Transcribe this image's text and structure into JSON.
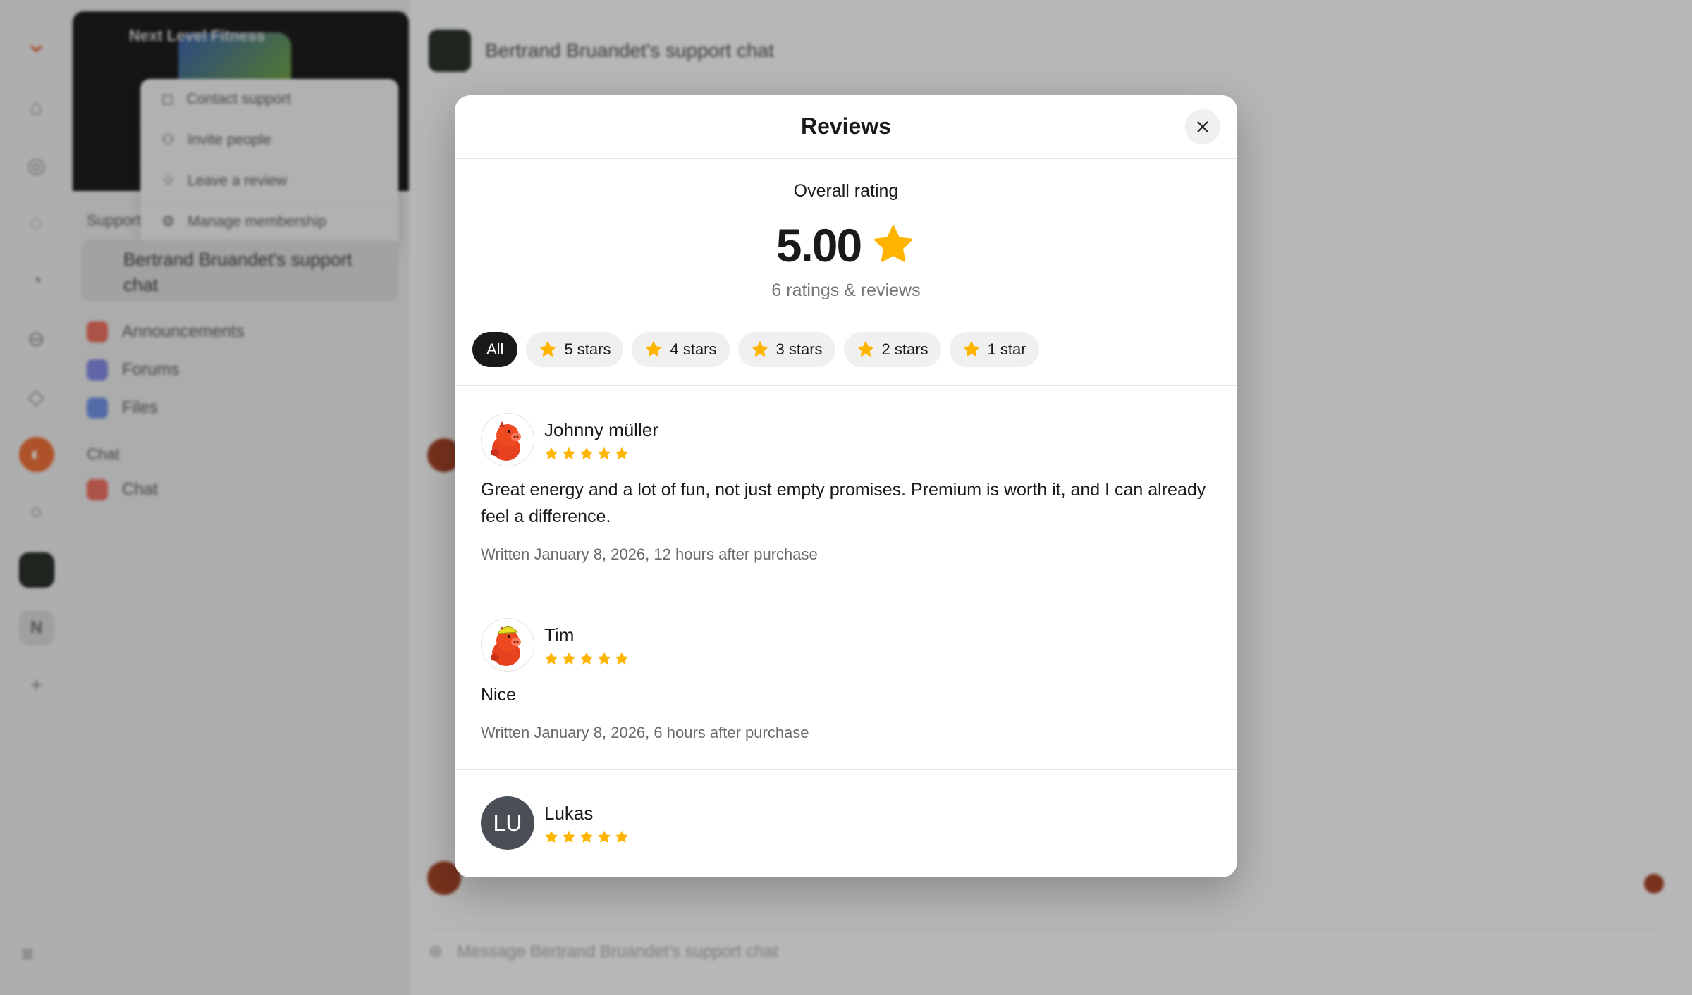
{
  "background": {
    "server_name": "Next Level Fitness",
    "context_menu": [
      "Contact support",
      "Invite people",
      "Leave a review",
      "Manage membership"
    ],
    "sidebar_section": "Support",
    "selected_channel": "Bertrand Bruandet's support chat",
    "channels": [
      "Announcements",
      "Forums",
      "Files"
    ],
    "chat_section": "Chat",
    "chat_channel": "Chat",
    "chat_title": "Bertrand Bruandet's support chat",
    "composer_placeholder": "Message Bertrand Bruandet's support chat",
    "rail_badge": "N"
  },
  "modal": {
    "title": "Reviews",
    "overall_label": "Overall rating",
    "score": "5.00",
    "count_text": "6 ratings & reviews",
    "filters": [
      {
        "label": "All",
        "active": true,
        "star": false
      },
      {
        "label": "5 stars",
        "active": false,
        "star": true
      },
      {
        "label": "4 stars",
        "active": false,
        "star": true
      },
      {
        "label": "3 stars",
        "active": false,
        "star": true
      },
      {
        "label": "2 stars",
        "active": false,
        "star": true
      },
      {
        "label": "1 star",
        "active": false,
        "star": true
      }
    ],
    "reviews": [
      {
        "name": "Johnny müller",
        "avatar": "pig-avatar-icon",
        "rating": 5,
        "text": "Great energy and a lot of fun, not just empty promises. Premium is worth it, and I can already feel a difference.",
        "meta": "Written January 8, 2026, 12 hours after purchase"
      },
      {
        "name": "Tim",
        "avatar": "pig-helmet-avatar-icon",
        "rating": 5,
        "text": "Nice",
        "meta": "Written January 8, 2026, 6 hours after purchase"
      },
      {
        "name": "Lukas",
        "avatar_initials": "LU",
        "rating": 5,
        "text": "",
        "meta": ""
      }
    ]
  },
  "colors": {
    "star": "#FFB400",
    "chip_active": "#1a1a1a",
    "chip_bg": "#f0f0f0",
    "initials_avatar": "#4a4f55"
  }
}
